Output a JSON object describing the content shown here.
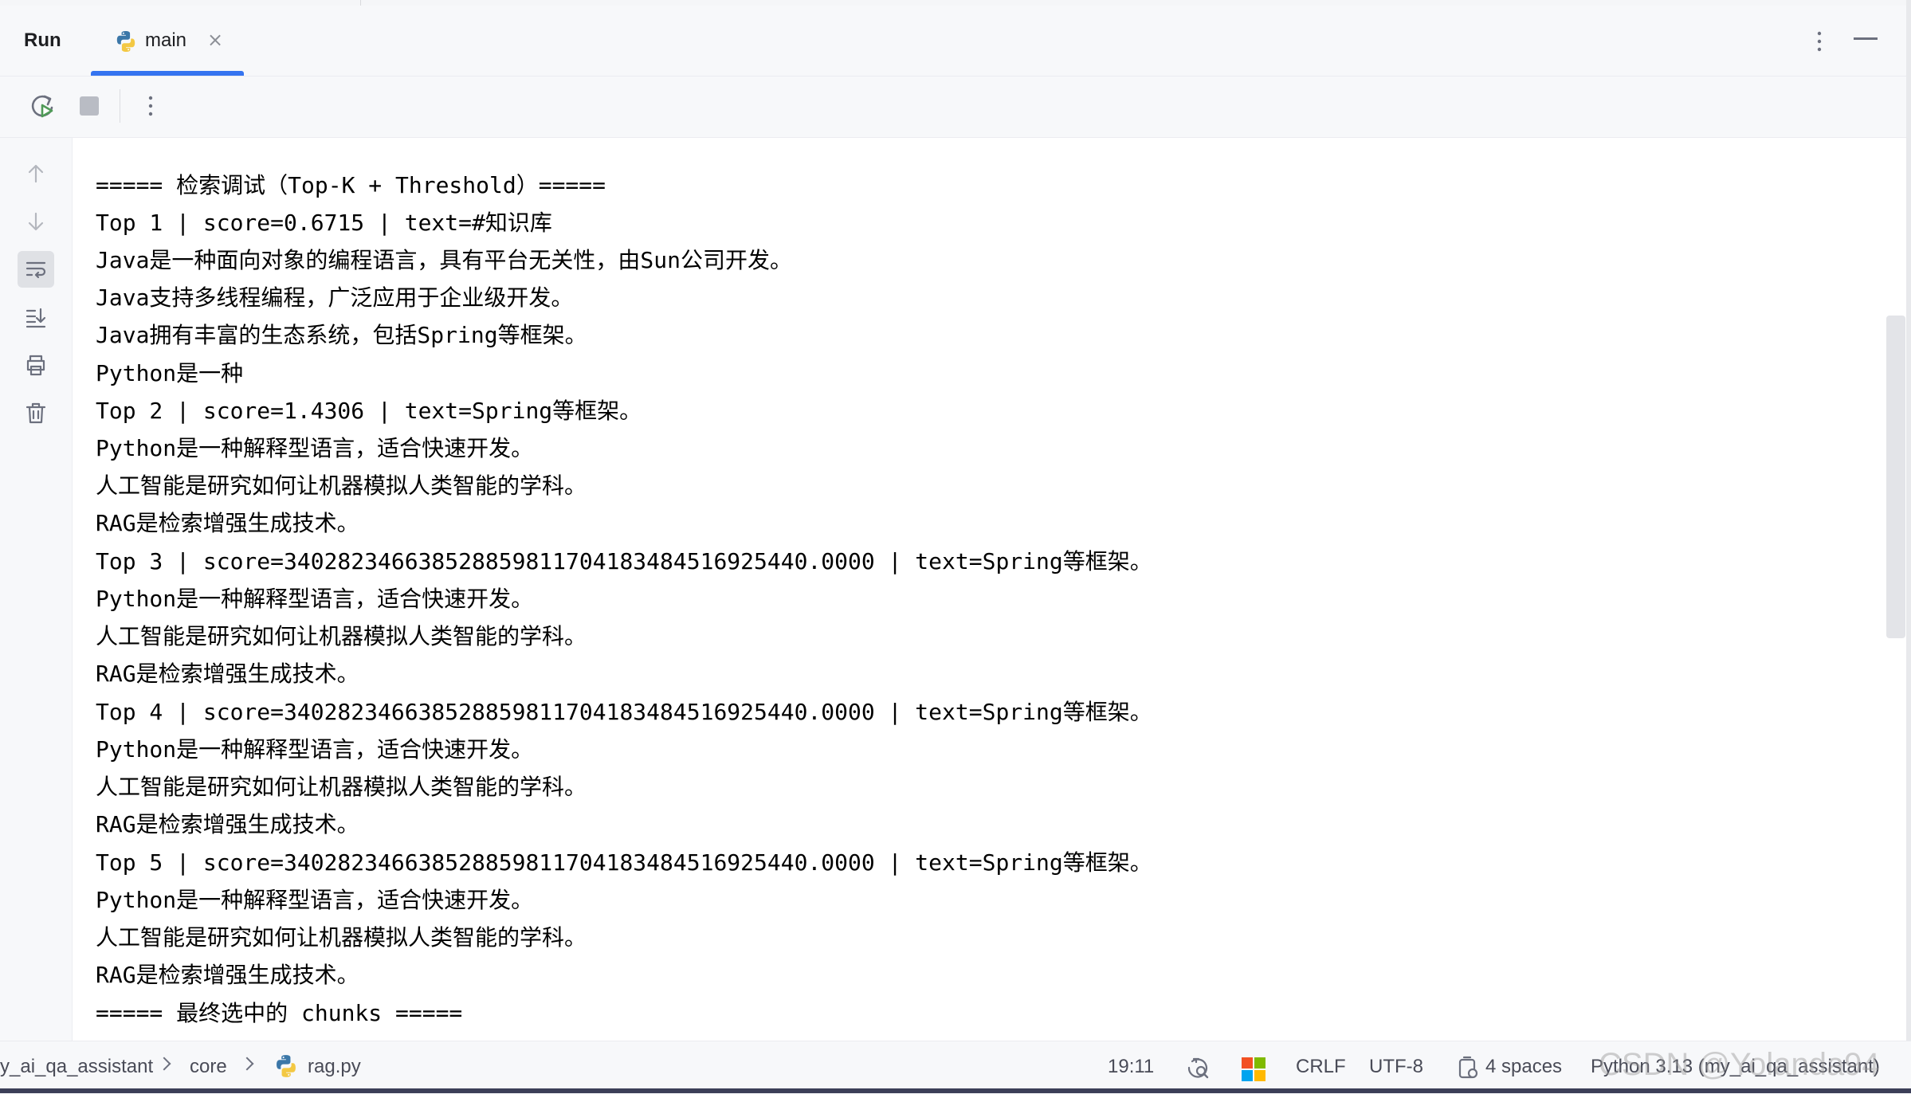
{
  "run_panel": {
    "title": "Run",
    "tabs": [
      {
        "label": "main",
        "icon": "python-icon",
        "active": true
      }
    ]
  },
  "toolbar": {
    "buttons": [
      "rerun-icon",
      "stop-icon",
      "more-icon"
    ]
  },
  "side_actions": [
    "arrow-up-icon",
    "arrow-down-icon",
    "soft-wrap-icon",
    "scroll-to-end-icon",
    "print-icon",
    "trash-icon"
  ],
  "console_lines": [
    "===== 检索调试（Top-K + Threshold）=====",
    "Top 1 | score=0.6715 | text=#知识库",
    "Java是一种面向对象的编程语言，具有平台无关性，由Sun公司开发。",
    "Java支持多线程编程，广泛应用于企业级开发。",
    "Java拥有丰富的生态系统，包括Spring等框架。",
    "Python是一种",
    "Top 2 | score=1.4306 | text=Spring等框架。",
    "Python是一种解释型语言，适合快速开发。",
    "人工智能是研究如何让机器模拟人类智能的学科。",
    "RAG是检索增强生成技术。",
    "Top 3 | score=340282346638528859811704183484516925440.0000 | text=Spring等框架。",
    "Python是一种解释型语言，适合快速开发。",
    "人工智能是研究如何让机器模拟人类智能的学科。",
    "RAG是检索增强生成技术。",
    "Top 4 | score=340282346638528859811704183484516925440.0000 | text=Spring等框架。",
    "Python是一种解释型语言，适合快速开发。",
    "人工智能是研究如何让机器模拟人类智能的学科。",
    "RAG是检索增强生成技术。",
    "Top 5 | score=340282346638528859811704183484516925440.0000 | text=Spring等框架。",
    "Python是一种解释型语言，适合快速开发。",
    "人工智能是研究如何让机器模拟人类智能的学科。",
    "RAG是检索增强生成技术。",
    "===== 最终选中的 chunks ====="
  ],
  "status_bar": {
    "breadcrumb": [
      "y_ai_qa_assistant",
      "core",
      "rag.py"
    ],
    "position": "19:11",
    "line_ending": "CRLF",
    "encoding": "UTF-8",
    "indent": "4 spaces",
    "interpreter": "Python 3.13 (my_ai_qa_assistant)"
  },
  "watermark": "CSDN @Yolanda94",
  "colors": {
    "accent": "#3574f0",
    "python_blue": "#3b77a8",
    "python_yellow": "#f3c843",
    "rerun_green": "#4f9a57"
  }
}
